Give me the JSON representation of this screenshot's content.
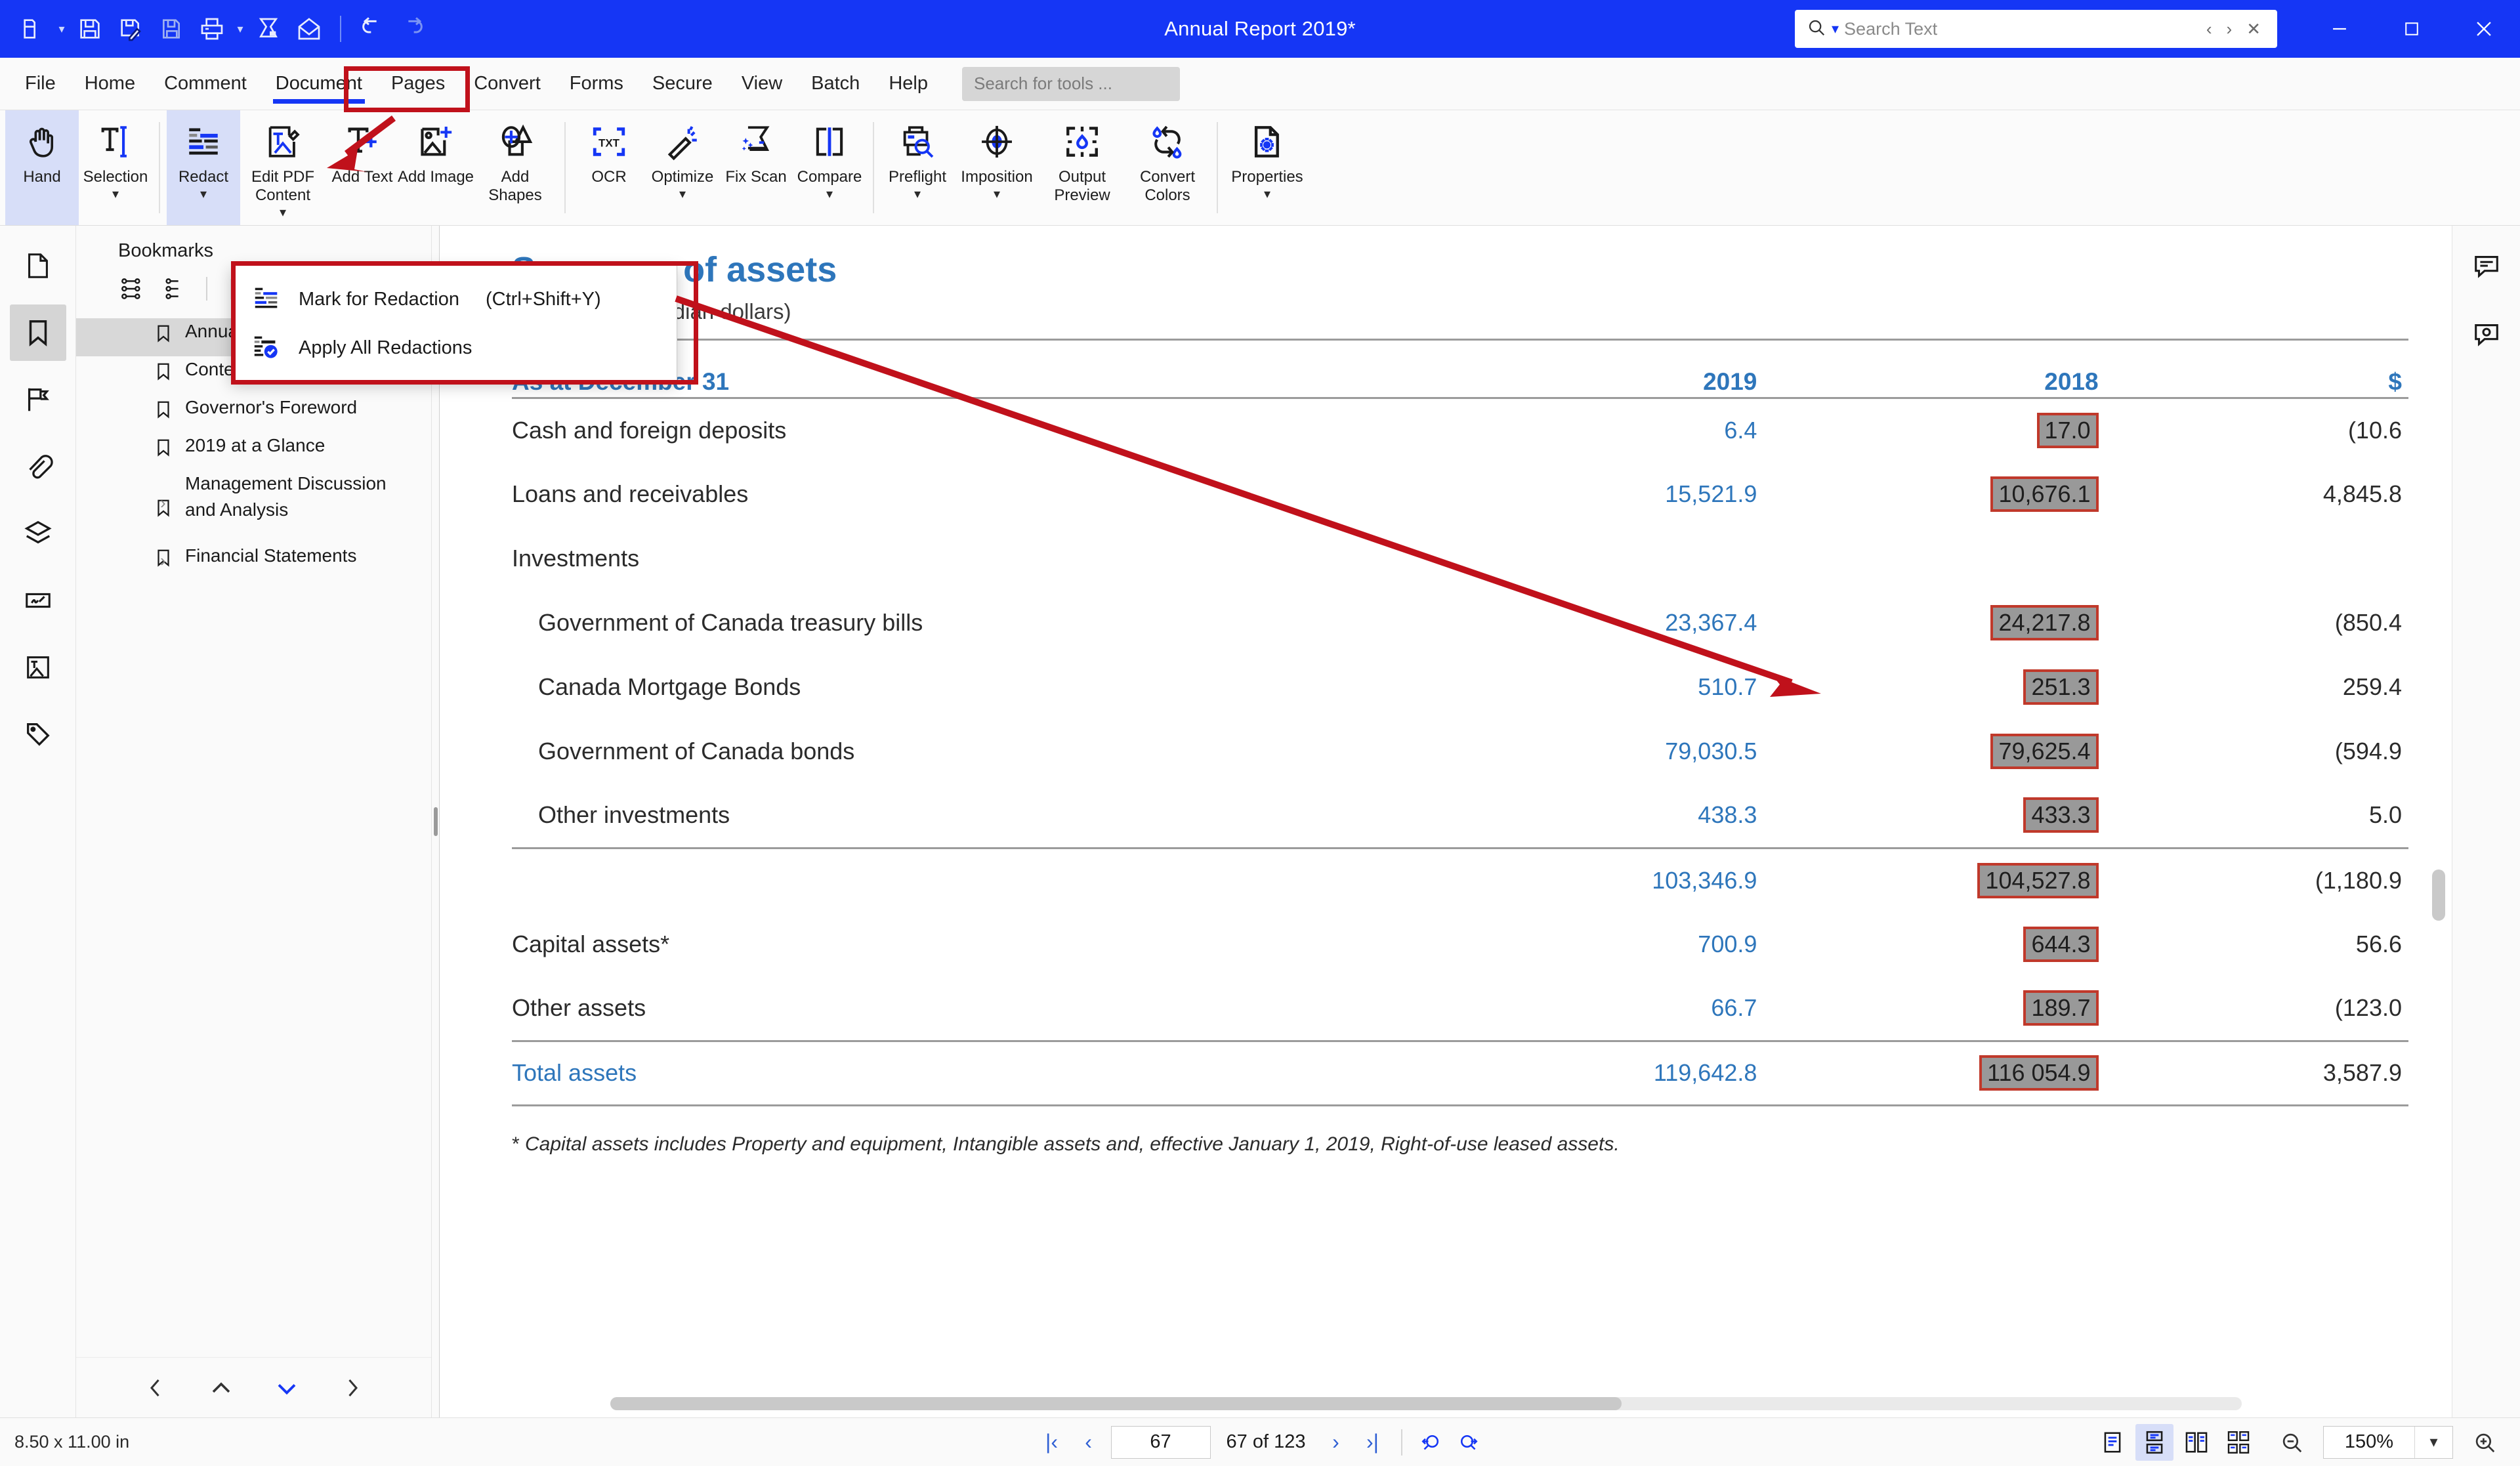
{
  "titlebar": {
    "document_title": "Annual Report 2019*",
    "search_placeholder": "Search Text",
    "quick_access": [
      {
        "name": "open-file",
        "label": "Open"
      },
      {
        "name": "save",
        "label": "Save"
      },
      {
        "name": "save-as-edit",
        "label": "Save As"
      },
      {
        "name": "save-copy",
        "label": "Save a Copy"
      },
      {
        "name": "print",
        "label": "Print"
      },
      {
        "name": "scan",
        "label": "Scan"
      },
      {
        "name": "email",
        "label": "Email"
      },
      {
        "name": "undo",
        "label": "Undo"
      },
      {
        "name": "redo",
        "label": "Redo"
      }
    ],
    "window_controls": {
      "minimize": "–",
      "maximize": "☐",
      "close": "✕"
    },
    "accent_color": "#1536f5"
  },
  "menubar": {
    "items": [
      {
        "label": "File",
        "active": false
      },
      {
        "label": "Home",
        "active": false
      },
      {
        "label": "Comment",
        "active": false
      },
      {
        "label": "Document",
        "active": true
      },
      {
        "label": "Pages",
        "active": false
      },
      {
        "label": "Convert",
        "active": false
      },
      {
        "label": "Forms",
        "active": false
      },
      {
        "label": "Secure",
        "active": false
      },
      {
        "label": "View",
        "active": false
      },
      {
        "label": "Batch",
        "active": false
      },
      {
        "label": "Help",
        "active": false
      }
    ],
    "tool_search_placeholder": "Search for tools ..."
  },
  "ribbon": {
    "buttons": [
      {
        "label": "Hand",
        "icon": "hand-icon",
        "caret": false,
        "selected": true
      },
      {
        "label": "Selection",
        "icon": "text-selection-icon",
        "caret": true,
        "selected": false
      },
      {
        "label": "Redact",
        "icon": "redact-icon",
        "caret": true,
        "selected": true
      },
      {
        "label": "Edit PDF Content",
        "icon": "edit-content-icon",
        "caret": true,
        "selected": false
      },
      {
        "label": "Add Text",
        "icon": "add-text-icon",
        "caret": false,
        "selected": false
      },
      {
        "label": "Add Image",
        "icon": "add-image-icon",
        "caret": false,
        "selected": false
      },
      {
        "label": "Add Shapes",
        "icon": "add-shapes-icon",
        "caret": true,
        "selected": false
      },
      {
        "label": "OCR",
        "icon": "ocr-icon",
        "caret": false,
        "selected": false
      },
      {
        "label": "Optimize",
        "icon": "optimize-wand-icon",
        "caret": true,
        "selected": false
      },
      {
        "label": "Fix Scan",
        "icon": "fix-scan-icon",
        "caret": true,
        "selected": false
      },
      {
        "label": "Compare",
        "icon": "compare-icon",
        "caret": true,
        "selected": false
      },
      {
        "label": "Preflight",
        "icon": "preflight-icon",
        "caret": true,
        "selected": false
      },
      {
        "label": "Imposition",
        "icon": "imposition-icon",
        "caret": true,
        "selected": false
      },
      {
        "label": "Output Preview",
        "icon": "output-preview-icon",
        "caret": false,
        "selected": false
      },
      {
        "label": "Convert Colors",
        "icon": "convert-colors-icon",
        "caret": false,
        "selected": false
      },
      {
        "label": "Properties",
        "icon": "properties-icon",
        "caret": true,
        "selected": false
      }
    ]
  },
  "redact_menu": {
    "items": [
      {
        "label": "Mark for Redaction",
        "shortcut": "(Ctrl+Shift+Y)",
        "icon": "mark-redaction-icon"
      },
      {
        "label": "Apply All Redactions",
        "shortcut": "",
        "icon": "apply-redactions-icon"
      }
    ]
  },
  "sidebar": {
    "panel_title": "Bookmarks",
    "rail_icons": [
      {
        "name": "pages-thumbnails-icon",
        "active": false
      },
      {
        "name": "bookmarks-icon",
        "active": true
      },
      {
        "name": "annotations-flag-icon",
        "active": false
      },
      {
        "name": "attachments-paperclip-icon",
        "active": false
      },
      {
        "name": "layers-icon",
        "active": false
      },
      {
        "name": "signature-icon",
        "active": false
      },
      {
        "name": "image-text-icon",
        "active": false
      },
      {
        "name": "tags-icon",
        "active": false
      }
    ],
    "toolbar_icons": [
      {
        "name": "expand-all-icon"
      },
      {
        "name": "collapse-all-icon"
      },
      {
        "name": "add-bookmark-icon"
      },
      {
        "name": "delete-bookmark-icon"
      }
    ],
    "bookmarks": [
      {
        "label": "Annual Report 2019",
        "selected": true,
        "expandable": false
      },
      {
        "label": "Contents",
        "selected": false,
        "expandable": false
      },
      {
        "label": "Governor's Foreword",
        "selected": false,
        "expandable": false
      },
      {
        "label": "2019 at a Glance",
        "selected": false,
        "expandable": false
      },
      {
        "label": "Management Discussion and Analysis",
        "selected": false,
        "expandable": true
      },
      {
        "label": "Financial Statements",
        "selected": false,
        "expandable": true
      }
    ],
    "footer_icons": [
      {
        "name": "previous-bookmark-icon"
      },
      {
        "name": "move-up-icon"
      },
      {
        "name": "move-down-icon"
      },
      {
        "name": "next-bookmark-icon"
      }
    ]
  },
  "document": {
    "title": "Summary of assets",
    "subtitle": "(millions of Canadian dollars)",
    "footnote_plain_1": "* ",
    "footnote": "Capital assets includes Property and equipment, Intangible assets and, effective January 1, 2019, Right-of-use leased assets.",
    "table": {
      "headers": [
        "As at December 31",
        "2019",
        "2018",
        "$"
      ],
      "rows": [
        {
          "label": "Cash and foreign deposits",
          "indent": false,
          "bold_label": false,
          "v2019": "6.4",
          "v2018": "17.0",
          "redacted": true,
          "change": "(10.6"
        },
        {
          "label": "Loans and receivables",
          "indent": false,
          "bold_label": false,
          "v2019": "15,521.9",
          "v2018": "10,676.1",
          "redacted": true,
          "change": "4,845.8"
        },
        {
          "label": "Investments",
          "indent": false,
          "bold_label": false,
          "v2019": "",
          "v2018": "",
          "redacted": false,
          "change": ""
        },
        {
          "label": "Government of Canada treasury bills",
          "indent": true,
          "bold_label": false,
          "v2019": "23,367.4",
          "v2018": "24,217.8",
          "redacted": true,
          "change": "(850.4"
        },
        {
          "label": "Canada Mortgage Bonds",
          "indent": true,
          "bold_label": false,
          "v2019": "510.7",
          "v2018": "251.3",
          "redacted": true,
          "change": "259.4"
        },
        {
          "label": "Government of Canada bonds",
          "indent": true,
          "bold_label": false,
          "v2019": "79,030.5",
          "v2018": "79,625.4",
          "redacted": true,
          "change": "(594.9"
        },
        {
          "label": "Other investments",
          "indent": true,
          "bold_label": false,
          "v2019": "438.3",
          "v2018": "433.3",
          "redacted": true,
          "change": "5.0"
        }
      ],
      "subtotal": {
        "label": "",
        "v2019": "103,346.9",
        "v2018": "104,527.8",
        "redacted": true,
        "change": "(1,180.9"
      },
      "rows_after": [
        {
          "label": "Capital assets*",
          "indent": false,
          "v2019": "700.9",
          "v2018": "644.3",
          "redacted": true,
          "change": "56.6"
        },
        {
          "label": "Other assets",
          "indent": false,
          "v2019": "66.7",
          "v2018": "189.7",
          "redacted": true,
          "change": "(123.0"
        }
      ],
      "total": {
        "label": "Total assets",
        "v2019": "119,642.8",
        "v2018": "116 054.9",
        "redacted": true,
        "change": "3,587.9"
      }
    }
  },
  "rightrail": {
    "icons": [
      {
        "name": "comments-panel-icon"
      },
      {
        "name": "review-panel-icon"
      }
    ]
  },
  "statusbar": {
    "page_size": "8.50 x 11.00 in",
    "page_current": "67",
    "page_of": "67 of 123",
    "zoom_level": "150%",
    "nav": {
      "first": "|‹",
      "prev": "‹",
      "next": "›",
      "last": "›|"
    },
    "view_modes": [
      {
        "name": "single-page-view-icon",
        "active": false
      },
      {
        "name": "continuous-scroll-view-icon",
        "active": true
      },
      {
        "name": "two-page-view-icon",
        "active": false
      },
      {
        "name": "two-page-continuous-view-icon",
        "active": false
      }
    ],
    "zoom_out_label": "Zoom Out",
    "zoom_in_label": "Zoom In"
  },
  "colors": {
    "title_bar": "#1536f5",
    "accent_blue": "#2e76bb",
    "redaction_fill": "#999999",
    "redaction_border": "#c0392b",
    "annotation_red": "#c0111b"
  }
}
